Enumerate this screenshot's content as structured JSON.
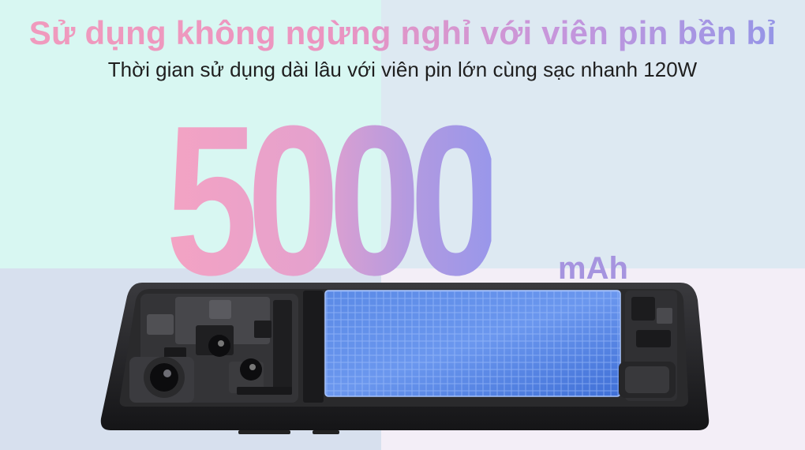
{
  "headline": "Sử dụng không ngừng nghỉ với viên pin bền bỉ",
  "subheadline": "Thời gian sử dụng dài lâu với viên pin lớn cùng sạc nhanh 120W",
  "battery": {
    "capacity": "5000",
    "unit": "mAh"
  },
  "colors": {
    "headline_start": "#f09bbd",
    "headline_end": "#8f95e8",
    "number_pink": "#f4a3c3",
    "number_purple": "#9997ea",
    "battery_blue": "#4f7fe0",
    "phone_frame": "#2b2b2e"
  }
}
